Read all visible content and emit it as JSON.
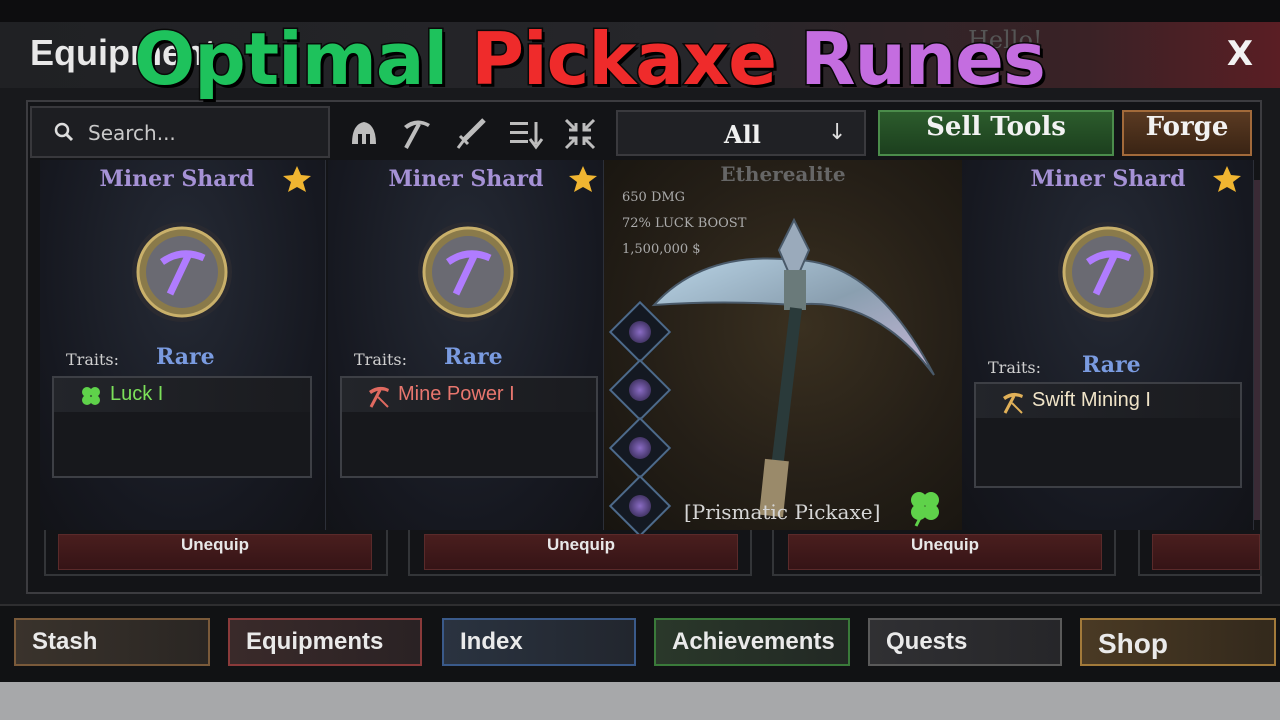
{
  "window": {
    "title": "Equipment",
    "greeting": "Hello!",
    "close_label": "X"
  },
  "overlay": {
    "part1": "Optimal",
    "part2": "Pickaxe",
    "part3": "Runes"
  },
  "toolbar": {
    "search_placeholder": "Search...",
    "filter_icons": [
      "helmet-icon",
      "pickaxe-icon",
      "sword-icon",
      "sort-icon",
      "collapse-icon"
    ],
    "dropdown_value": "All",
    "dropdown_arrow": "↓",
    "sell_label": "Sell Tools",
    "forge_label": "Forge"
  },
  "cards": [
    {
      "name": "Miner Shard",
      "traits_label": "Traits:",
      "rarity": "Rare",
      "trait": "Luck I",
      "trait_color": "#7ce05a",
      "trait_icon": "clover-icon",
      "action": "Unequip"
    },
    {
      "name": "Miner Shard",
      "traits_label": "Traits:",
      "rarity": "Rare",
      "trait": "Mine Power I",
      "trait_color": "#e8766e",
      "trait_icon": "pickaxe-icon",
      "action": "Unequip"
    },
    {
      "name": "Miner Shard",
      "traits_label": "Traits:",
      "rarity": "Rare",
      "trait": "Swift Mining I",
      "trait_color": "#f0e4c8",
      "trait_icon": "pickaxe-icon",
      "action": "Unequip"
    }
  ],
  "center": {
    "name": "Etherealite",
    "stats": [
      "650 DMG",
      "72% LUCK BOOST",
      "1,500,000 $"
    ],
    "item_name": "[Prismatic Pickaxe]",
    "rune_slots": 4
  },
  "nav": [
    {
      "label": "Stash",
      "color": "#7a5a3a"
    },
    {
      "label": "Equipments",
      "color": "#8a3a3a"
    },
    {
      "label": "Index",
      "color": "#3a5a8a"
    },
    {
      "label": "Achievements",
      "color": "#3a7a3a"
    },
    {
      "label": "Quests",
      "color": "#5a5a5a"
    },
    {
      "label": "Shop",
      "color": "#a27a3a"
    }
  ],
  "colors": {
    "rarity": "#7a9be0",
    "card_name": "#a692d6",
    "star": "#f0b531"
  }
}
